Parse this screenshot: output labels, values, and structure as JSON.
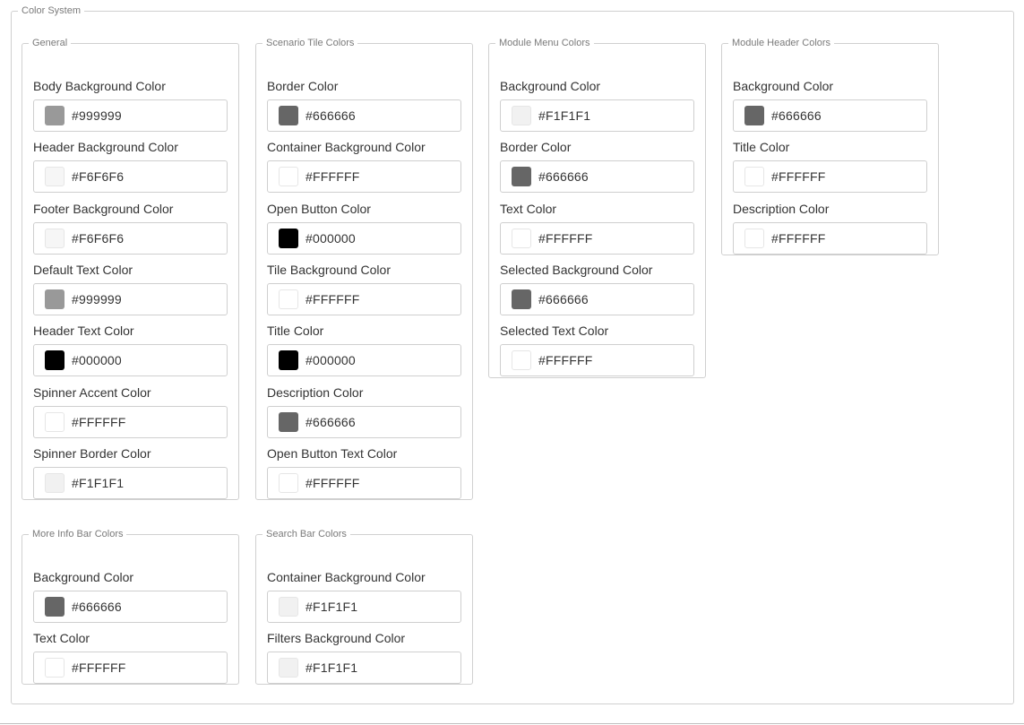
{
  "color_system": {
    "legend": "Color System",
    "groups": [
      {
        "legend": "General",
        "fields": [
          {
            "label": "Body Background Color",
            "value": "#999999",
            "swatch": "#999999"
          },
          {
            "label": "Header Background Color",
            "value": "#F6F6F6",
            "swatch": "#F6F6F6"
          },
          {
            "label": "Footer Background Color",
            "value": "#F6F6F6",
            "swatch": "#F6F6F6"
          },
          {
            "label": "Default Text Color",
            "value": "#999999",
            "swatch": "#999999"
          },
          {
            "label": "Header Text Color",
            "value": "#000000",
            "swatch": "#000000"
          },
          {
            "label": "Spinner Accent Color",
            "value": "#FFFFFF",
            "swatch": "#FFFFFF"
          },
          {
            "label": "Spinner Border Color",
            "value": "#F1F1F1",
            "swatch": "#F1F1F1"
          }
        ]
      },
      {
        "legend": "Scenario Tile Colors",
        "fields": [
          {
            "label": "Border Color",
            "value": "#666666",
            "swatch": "#666666"
          },
          {
            "label": "Container Background Color",
            "value": "#FFFFFF",
            "swatch": "#FFFFFF"
          },
          {
            "label": "Open Button Color",
            "value": "#000000",
            "swatch": "#000000"
          },
          {
            "label": "Tile Background Color",
            "value": "#FFFFFF",
            "swatch": "#FFFFFF"
          },
          {
            "label": "Title Color",
            "value": "#000000",
            "swatch": "#000000"
          },
          {
            "label": "Description Color",
            "value": "#666666",
            "swatch": "#666666"
          },
          {
            "label": "Open Button Text Color",
            "value": "#FFFFFF",
            "swatch": "#FFFFFF"
          }
        ]
      },
      {
        "legend": "Module Menu Colors",
        "fields": [
          {
            "label": "Background Color",
            "value": "#F1F1F1",
            "swatch": "#F1F1F1"
          },
          {
            "label": "Border Color",
            "value": "#666666",
            "swatch": "#666666"
          },
          {
            "label": "Text Color",
            "value": "#FFFFFF",
            "swatch": "#FFFFFF"
          },
          {
            "label": "Selected Background Color",
            "value": "#666666",
            "swatch": "#666666"
          },
          {
            "label": "Selected Text Color",
            "value": "#FFFFFF",
            "swatch": "#FFFFFF"
          }
        ]
      },
      {
        "legend": "Module Header Colors",
        "fields": [
          {
            "label": "Background Color",
            "value": "#666666",
            "swatch": "#666666"
          },
          {
            "label": "Title Color",
            "value": "#FFFFFF",
            "swatch": "#FFFFFF"
          },
          {
            "label": "Description Color",
            "value": "#FFFFFF",
            "swatch": "#FFFFFF"
          }
        ]
      },
      {
        "legend": "More Info Bar Colors",
        "fields": [
          {
            "label": "Background Color",
            "value": "#666666",
            "swatch": "#666666"
          },
          {
            "label": "Text Color",
            "value": "#FFFFFF",
            "swatch": "#FFFFFF"
          }
        ]
      },
      {
        "legend": "Search Bar Colors",
        "fields": [
          {
            "label": "Container Background Color",
            "value": "#F1F1F1",
            "swatch": "#F1F1F1"
          },
          {
            "label": "Filters Background Color",
            "value": "#F1F1F1",
            "swatch": "#F1F1F1"
          }
        ]
      }
    ]
  }
}
